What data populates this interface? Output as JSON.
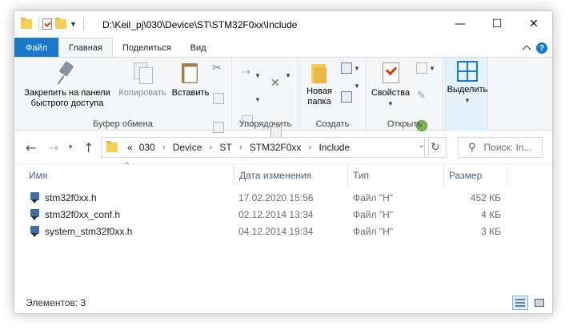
{
  "window": {
    "title": "D:\\Keil_pj\\030\\Device\\ST\\STM32F0xx\\Include",
    "controls": {
      "minimize": "—",
      "maximize": "☐",
      "close": "✕"
    }
  },
  "tabs": [
    {
      "label": "Файл"
    },
    {
      "label": "Главная"
    },
    {
      "label": "Поделиться"
    },
    {
      "label": "Вид"
    }
  ],
  "help_label": "?",
  "ribbon": {
    "clipboard": {
      "label": "Буфер обмена",
      "pin_line1": "Закрепить на панели",
      "pin_line2": "быстрого доступа",
      "copy": "Копировать",
      "paste": "Вставить"
    },
    "organize": {
      "label": "Упорядочить"
    },
    "new": {
      "label": "Создать",
      "new_folder_line1": "Новая",
      "new_folder_line2": "папка"
    },
    "open": {
      "label": "Открыть",
      "properties": "Свойства"
    },
    "select": {
      "select_label": "Выделить"
    }
  },
  "address": {
    "overflow": "«",
    "crumbs": [
      "030",
      "Device",
      "ST",
      "STM32F0xx",
      "Include"
    ]
  },
  "search": {
    "placeholder": "Поиск: In..."
  },
  "columns": {
    "name": "Имя",
    "date": "Дата изменения",
    "type": "Тип",
    "size": "Размер"
  },
  "files": [
    {
      "name": "stm32f0xx.h",
      "date": "17.02.2020 15:56",
      "type": "Файл \"H\"",
      "size": "452 КБ"
    },
    {
      "name": "stm32f0xx_conf.h",
      "date": "02.12.2014 13:34",
      "type": "Файл \"H\"",
      "size": "4 КБ"
    },
    {
      "name": "system_stm32f0xx.h",
      "date": "04.12.2014 19:34",
      "type": "Файл \"H\"",
      "size": "3 КБ"
    }
  ],
  "status": {
    "items_text": "Элементов: 3"
  },
  "colors": {
    "accent": "#1979ca",
    "header_text": "#4d6185",
    "folder": "#f7cf55"
  }
}
